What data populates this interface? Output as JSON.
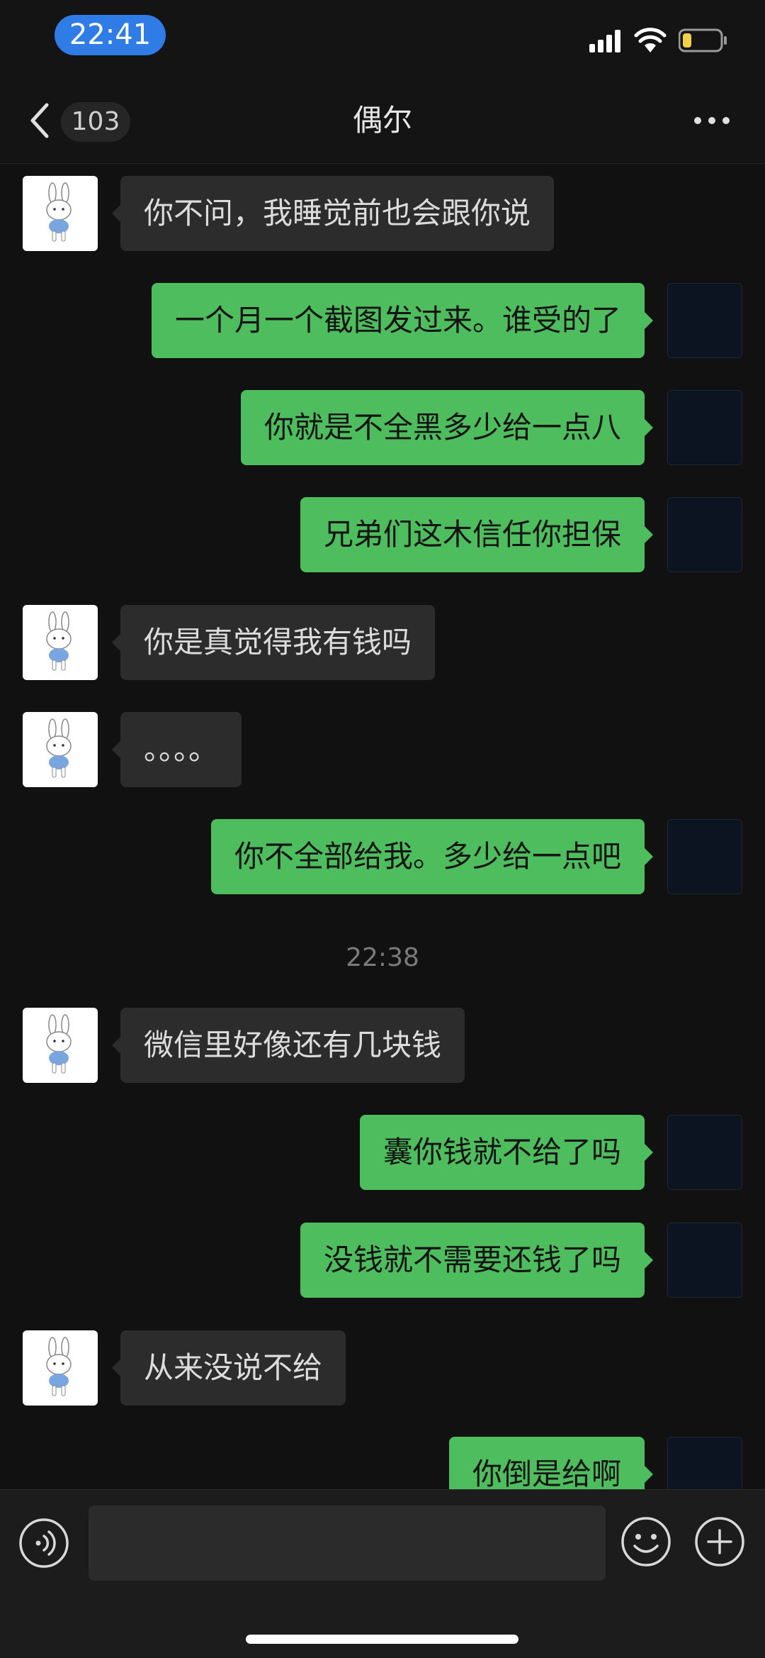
{
  "status_bar": {
    "time": "22:41",
    "battery_color": "#f2d04a",
    "time_pill_color": "#2f7ce6"
  },
  "nav": {
    "unread_count": "103",
    "title": "偶尔",
    "back_icon": "chevron-left-icon",
    "more_icon": "more-dots-icon"
  },
  "messages": [
    {
      "side": "in",
      "text": "你不问，我睡觉前也会跟你说"
    },
    {
      "side": "out",
      "text": "一个月一个截图发过来。谁受的了"
    },
    {
      "side": "out",
      "text": "你就是不全黑多少给一点八"
    },
    {
      "side": "out",
      "text": "兄弟们这木信任你担保"
    },
    {
      "side": "in",
      "text": "你是真觉得我有钱吗"
    },
    {
      "side": "in",
      "text": "。。。。"
    },
    {
      "side": "out",
      "text": "你不全部给我。多少给一点吧"
    },
    {
      "side": "in",
      "text": "微信里好像还有几块钱"
    },
    {
      "side": "out",
      "text": "囊你钱就不给了吗"
    },
    {
      "side": "out",
      "text": "没钱就不需要还钱了吗"
    },
    {
      "side": "in",
      "text": "从来没说不给"
    },
    {
      "side": "out",
      "text": "你倒是给啊"
    }
  ],
  "timestamp": "22:38",
  "input_bar": {
    "voice_icon": "voice-icon",
    "emoji_icon": "emoji-icon",
    "add_icon": "plus-icon",
    "input_value": ""
  },
  "colors": {
    "bubble_out": "#4ebd5e",
    "bubble_in": "#2c2c2c",
    "background": "#111111"
  }
}
